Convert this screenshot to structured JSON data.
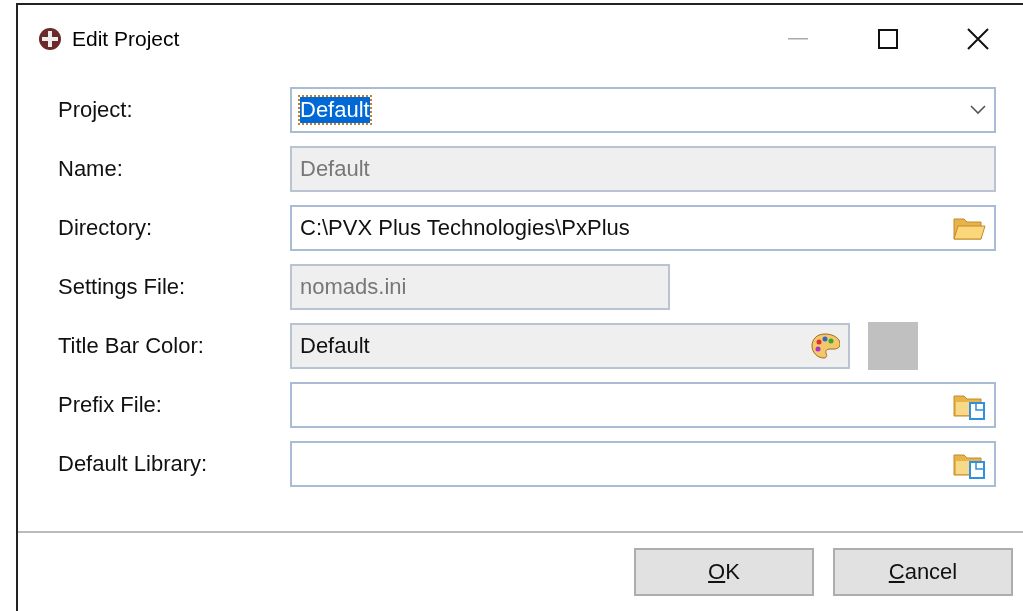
{
  "window": {
    "title": "Edit Project"
  },
  "fields": [
    {
      "label": "Project:",
      "kind": "combo",
      "value": "Default",
      "disabled": false,
      "highlighted": true
    },
    {
      "label": "Name:",
      "kind": "text",
      "value": "Default",
      "disabled": true
    },
    {
      "label": "Directory:",
      "kind": "folder",
      "value": "C:\\PVX Plus Technologies\\PxPlus",
      "disabled": false
    },
    {
      "label": "Settings File:",
      "kind": "short",
      "value": "nomads.ini",
      "disabled": true
    },
    {
      "label": "Title Bar Color:",
      "kind": "color",
      "value": "Default",
      "disabled": false,
      "color": "#c0c0c0"
    },
    {
      "label": "Prefix File:",
      "kind": "file",
      "disabled": false
    },
    {
      "label": "Default Library:",
      "kind": "file",
      "disabled": false
    }
  ],
  "buttons": [
    "OK",
    "Cancel"
  ]
}
